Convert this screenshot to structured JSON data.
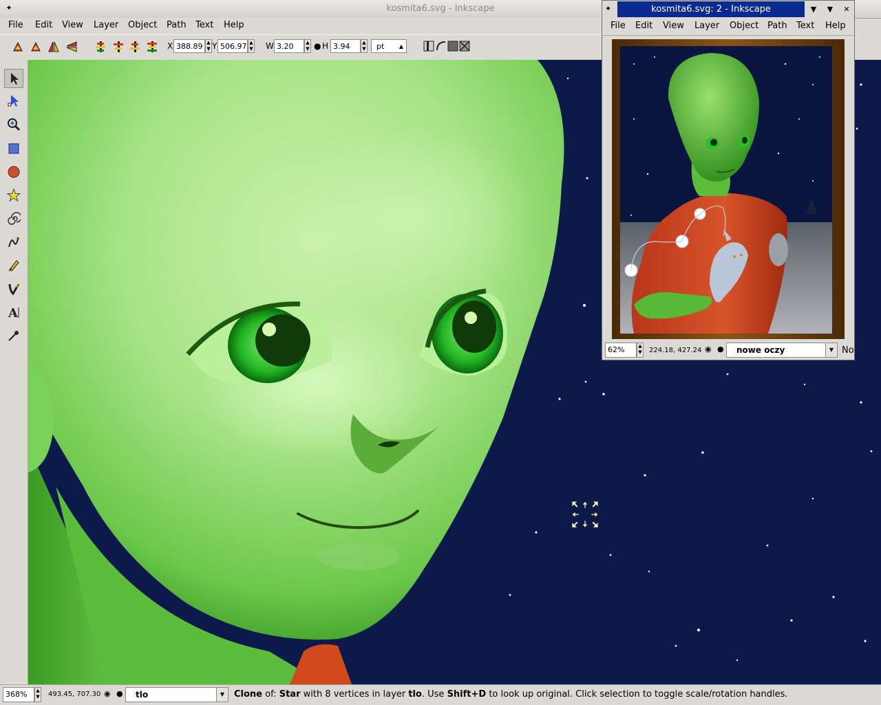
{
  "main_window": {
    "title": "kosmita6.svg - Inkscape",
    "menu": [
      "File",
      "Edit",
      "View",
      "Layer",
      "Object",
      "Path",
      "Text",
      "Help"
    ],
    "toolbar": {
      "x_label": "X",
      "x_value": "388.89",
      "y_label": "Y",
      "y_value": "506.97",
      "w_label": "W",
      "w_value": "3.20",
      "h_label": "H",
      "h_value": "3.94",
      "unit": "pt"
    },
    "status": {
      "zoom": "368%",
      "coords": "493.45, 707.30",
      "layer": "tlo",
      "message_parts": [
        {
          "text": "Clone",
          "bold": true
        },
        {
          "text": " of: ",
          "bold": false
        },
        {
          "text": "Star",
          "bold": true
        },
        {
          "text": " with 8 vertices in layer ",
          "bold": false
        },
        {
          "text": "tlo",
          "bold": true
        },
        {
          "text": ". Use ",
          "bold": false
        },
        {
          "text": "Shift+D",
          "bold": true
        },
        {
          "text": " to look up original. Click selection to toggle scale/rotation handles.",
          "bold": false
        }
      ]
    }
  },
  "second_window": {
    "title": "kosmita6.svg: 2 - Inkscape",
    "menu": [
      "File",
      "Edit",
      "View",
      "Layer",
      "Object",
      "Path",
      "Text",
      "Help"
    ],
    "status": {
      "zoom": "62%",
      "coords": "224.18, 427.24",
      "layer": "nowe oczy",
      "truncated": "No"
    }
  },
  "colors": {
    "night_sky": "#0b1a4a",
    "alien_skin": "#9fe07a",
    "iris": "#2fc02a",
    "sweater": "#c8421a",
    "frame": "#6b3a10",
    "active_title": "#0a2a8f"
  }
}
